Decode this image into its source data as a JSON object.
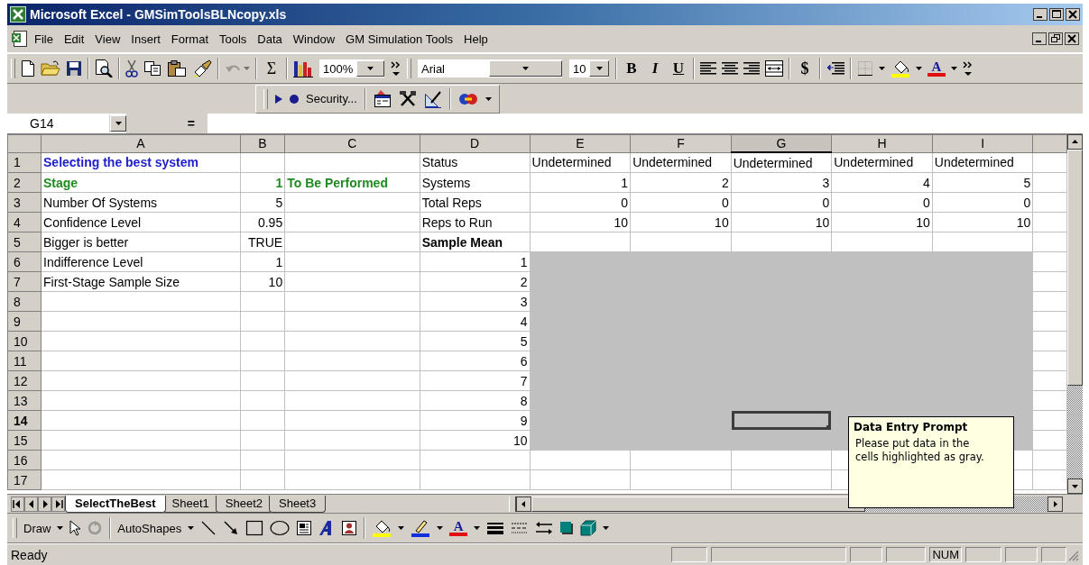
{
  "window": {
    "title": "Microsoft Excel - GMSimToolsBLNcopy.xls"
  },
  "menu": [
    "File",
    "Edit",
    "View",
    "Insert",
    "Format",
    "Tools",
    "Data",
    "Window",
    "GM Simulation Tools",
    "Help"
  ],
  "toolbar": {
    "undo_disabled": true,
    "sum": "Σ",
    "zoom": "100%",
    "font": "Arial",
    "font_size": "10",
    "bold": "B",
    "italic": "I",
    "underline": "U",
    "currency": "$",
    "font_color": "A"
  },
  "macro_toolbar": {
    "security": "Security..."
  },
  "formula_bar": {
    "name_box": "G14",
    "equals": "="
  },
  "sheet": {
    "columns": [
      {
        "label": "A",
        "selected": false
      },
      {
        "label": "B",
        "selected": false
      },
      {
        "label": "C",
        "selected": false
      },
      {
        "label": "D",
        "selected": false
      },
      {
        "label": "E",
        "selected": false
      },
      {
        "label": "F",
        "selected": false
      },
      {
        "label": "G",
        "selected": true
      },
      {
        "label": "H",
        "selected": false
      },
      {
        "label": "I",
        "selected": false
      }
    ],
    "rows": [
      {
        "label": "1",
        "selected": false,
        "cells": [
          {
            "text": "Selecting the best system",
            "kind": "title",
            "highlighted": false,
            "selected": false
          },
          {
            "kind": "empty",
            "highlighted": false,
            "selected": false
          },
          {
            "kind": "empty",
            "highlighted": false,
            "selected": false
          },
          {
            "text": "Status",
            "kind": "text",
            "highlighted": false,
            "selected": false
          },
          {
            "text": "Undetermined",
            "kind": "text",
            "highlighted": false,
            "selected": false
          },
          {
            "text": "Undetermined",
            "kind": "text",
            "highlighted": false,
            "selected": false
          },
          {
            "text": "Undetermined",
            "kind": "text",
            "highlighted": false,
            "selected": false
          },
          {
            "text": "Undetermined",
            "kind": "text",
            "highlighted": false,
            "selected": false
          },
          {
            "text": "Undetermined",
            "kind": "text",
            "highlighted": false,
            "selected": false
          }
        ]
      },
      {
        "label": "2",
        "selected": false,
        "cells": [
          {
            "text": "Stage",
            "kind": "stage",
            "highlighted": false,
            "selected": false
          },
          {
            "text": "1",
            "kind": "stage_number",
            "highlighted": false,
            "selected": false
          },
          {
            "text": "To Be Performed",
            "kind": "stage",
            "highlighted": false,
            "selected": false
          },
          {
            "text": "Systems",
            "kind": "text",
            "highlighted": false,
            "selected": false
          },
          {
            "text": "1",
            "kind": "number",
            "highlighted": false,
            "selected": false
          },
          {
            "text": "2",
            "kind": "number",
            "highlighted": false,
            "selected": false
          },
          {
            "text": "3",
            "kind": "number",
            "highlighted": false,
            "selected": false
          },
          {
            "text": "4",
            "kind": "number",
            "highlighted": false,
            "selected": false
          },
          {
            "text": "5",
            "kind": "number",
            "highlighted": false,
            "selected": false
          }
        ]
      },
      {
        "label": "3",
        "selected": false,
        "cells": [
          {
            "text": "Number Of Systems",
            "kind": "text",
            "highlighted": false,
            "selected": false
          },
          {
            "text": "5",
            "kind": "number",
            "highlighted": false,
            "selected": false
          },
          {
            "kind": "empty",
            "highlighted": false,
            "selected": false
          },
          {
            "text": "Total Reps",
            "kind": "text",
            "highlighted": false,
            "selected": false
          },
          {
            "text": "0",
            "kind": "number",
            "highlighted": false,
            "selected": false
          },
          {
            "text": "0",
            "kind": "number",
            "highlighted": false,
            "selected": false
          },
          {
            "text": "0",
            "kind": "number",
            "highlighted": false,
            "selected": false
          },
          {
            "text": "0",
            "kind": "number",
            "highlighted": false,
            "selected": false
          },
          {
            "text": "0",
            "kind": "number",
            "highlighted": false,
            "selected": false
          }
        ]
      },
      {
        "label": "4",
        "selected": false,
        "cells": [
          {
            "text": "Confidence Level",
            "kind": "text",
            "highlighted": false,
            "selected": false
          },
          {
            "text": "0.95",
            "kind": "number",
            "highlighted": false,
            "selected": false
          },
          {
            "kind": "empty",
            "highlighted": false,
            "selected": false
          },
          {
            "text": "Reps to Run",
            "kind": "text",
            "highlighted": false,
            "selected": false
          },
          {
            "text": "10",
            "kind": "number",
            "highlighted": false,
            "selected": false
          },
          {
            "text": "10",
            "kind": "number",
            "highlighted": false,
            "selected": false
          },
          {
            "text": "10",
            "kind": "number",
            "highlighted": false,
            "selected": false
          },
          {
            "text": "10",
            "kind": "number",
            "highlighted": false,
            "selected": false
          },
          {
            "text": "10",
            "kind": "number",
            "highlighted": false,
            "selected": false
          }
        ]
      },
      {
        "label": "5",
        "selected": false,
        "cells": [
          {
            "text": "Bigger is better",
            "kind": "text",
            "highlighted": false,
            "selected": false
          },
          {
            "text": "TRUE",
            "kind": "number",
            "highlighted": false,
            "selected": false
          },
          {
            "kind": "empty",
            "highlighted": false,
            "selected": false
          },
          {
            "text": "Sample Mean",
            "kind": "heading",
            "highlighted": false,
            "selected": false
          },
          {
            "kind": "empty",
            "highlighted": false,
            "selected": false
          },
          {
            "kind": "empty",
            "highlighted": false,
            "selected": false
          },
          {
            "kind": "empty",
            "highlighted": false,
            "selected": false
          },
          {
            "kind": "empty",
            "highlighted": false,
            "selected": false
          },
          {
            "kind": "empty",
            "highlighted": false,
            "selected": false
          }
        ]
      },
      {
        "label": "6",
        "selected": false,
        "cells": [
          {
            "text": "Indifference Level",
            "kind": "text",
            "highlighted": false,
            "selected": false
          },
          {
            "text": "1",
            "kind": "number",
            "highlighted": false,
            "selected": false
          },
          {
            "kind": "empty",
            "highlighted": false,
            "selected": false
          },
          {
            "text": "1",
            "kind": "number",
            "highlighted": false,
            "selected": false
          },
          {
            "kind": "empty",
            "highlighted": true,
            "selected": false
          },
          {
            "kind": "empty",
            "highlighted": true,
            "selected": false
          },
          {
            "kind": "empty",
            "highlighted": true,
            "selected": false
          },
          {
            "kind": "empty",
            "highlighted": true,
            "selected": false
          },
          {
            "kind": "empty",
            "highlighted": true,
            "selected": false
          }
        ]
      },
      {
        "label": "7",
        "selected": false,
        "cells": [
          {
            "text": "First-Stage Sample Size",
            "kind": "text",
            "highlighted": false,
            "selected": false
          },
          {
            "text": "10",
            "kind": "number",
            "highlighted": false,
            "selected": false
          },
          {
            "kind": "empty",
            "highlighted": false,
            "selected": false
          },
          {
            "text": "2",
            "kind": "number",
            "highlighted": false,
            "selected": false
          },
          {
            "kind": "empty",
            "highlighted": true,
            "selected": false
          },
          {
            "kind": "empty",
            "highlighted": true,
            "selected": false
          },
          {
            "kind": "empty",
            "highlighted": true,
            "selected": false
          },
          {
            "kind": "empty",
            "highlighted": true,
            "selected": false
          },
          {
            "kind": "empty",
            "highlighted": true,
            "selected": false
          }
        ]
      },
      {
        "label": "8",
        "selected": false,
        "cells": [
          {
            "kind": "empty",
            "highlighted": false,
            "selected": false
          },
          {
            "kind": "empty",
            "highlighted": false,
            "selected": false
          },
          {
            "kind": "empty",
            "highlighted": false,
            "selected": false
          },
          {
            "text": "3",
            "kind": "number",
            "highlighted": false,
            "selected": false
          },
          {
            "kind": "empty",
            "highlighted": true,
            "selected": false
          },
          {
            "kind": "empty",
            "highlighted": true,
            "selected": false
          },
          {
            "kind": "empty",
            "highlighted": true,
            "selected": false
          },
          {
            "kind": "empty",
            "highlighted": true,
            "selected": false
          },
          {
            "kind": "empty",
            "highlighted": true,
            "selected": false
          }
        ]
      },
      {
        "label": "9",
        "selected": false,
        "cells": [
          {
            "kind": "empty",
            "highlighted": false,
            "selected": false
          },
          {
            "kind": "empty",
            "highlighted": false,
            "selected": false
          },
          {
            "kind": "empty",
            "highlighted": false,
            "selected": false
          },
          {
            "text": "4",
            "kind": "number",
            "highlighted": false,
            "selected": false
          },
          {
            "kind": "empty",
            "highlighted": true,
            "selected": false
          },
          {
            "kind": "empty",
            "highlighted": true,
            "selected": false
          },
          {
            "kind": "empty",
            "highlighted": true,
            "selected": false
          },
          {
            "kind": "empty",
            "highlighted": true,
            "selected": false
          },
          {
            "kind": "empty",
            "highlighted": true,
            "selected": false
          }
        ]
      },
      {
        "label": "10",
        "selected": false,
        "cells": [
          {
            "kind": "empty",
            "highlighted": false,
            "selected": false
          },
          {
            "kind": "empty",
            "highlighted": false,
            "selected": false
          },
          {
            "kind": "empty",
            "highlighted": false,
            "selected": false
          },
          {
            "text": "5",
            "kind": "number",
            "highlighted": false,
            "selected": false
          },
          {
            "kind": "empty",
            "highlighted": true,
            "selected": false
          },
          {
            "kind": "empty",
            "highlighted": true,
            "selected": false
          },
          {
            "kind": "empty",
            "highlighted": true,
            "selected": false
          },
          {
            "kind": "empty",
            "highlighted": true,
            "selected": false
          },
          {
            "kind": "empty",
            "highlighted": true,
            "selected": false
          }
        ]
      },
      {
        "label": "11",
        "selected": false,
        "cells": [
          {
            "kind": "empty",
            "highlighted": false,
            "selected": false
          },
          {
            "kind": "empty",
            "highlighted": false,
            "selected": false
          },
          {
            "kind": "empty",
            "highlighted": false,
            "selected": false
          },
          {
            "text": "6",
            "kind": "number",
            "highlighted": false,
            "selected": false
          },
          {
            "kind": "empty",
            "highlighted": true,
            "selected": false
          },
          {
            "kind": "empty",
            "highlighted": true,
            "selected": false
          },
          {
            "kind": "empty",
            "highlighted": true,
            "selected": false
          },
          {
            "kind": "empty",
            "highlighted": true,
            "selected": false
          },
          {
            "kind": "empty",
            "highlighted": true,
            "selected": false
          }
        ]
      },
      {
        "label": "12",
        "selected": false,
        "cells": [
          {
            "kind": "empty",
            "highlighted": false,
            "selected": false
          },
          {
            "kind": "empty",
            "highlighted": false,
            "selected": false
          },
          {
            "kind": "empty",
            "highlighted": false,
            "selected": false
          },
          {
            "text": "7",
            "kind": "number",
            "highlighted": false,
            "selected": false
          },
          {
            "kind": "empty",
            "highlighted": true,
            "selected": false
          },
          {
            "kind": "empty",
            "highlighted": true,
            "selected": false
          },
          {
            "kind": "empty",
            "highlighted": true,
            "selected": false
          },
          {
            "kind": "empty",
            "highlighted": true,
            "selected": false
          },
          {
            "kind": "empty",
            "highlighted": true,
            "selected": false
          }
        ]
      },
      {
        "label": "13",
        "selected": false,
        "cells": [
          {
            "kind": "empty",
            "highlighted": false,
            "selected": false
          },
          {
            "kind": "empty",
            "highlighted": false,
            "selected": false
          },
          {
            "kind": "empty",
            "highlighted": false,
            "selected": false
          },
          {
            "text": "8",
            "kind": "number",
            "highlighted": false,
            "selected": false
          },
          {
            "kind": "empty",
            "highlighted": true,
            "selected": false
          },
          {
            "kind": "empty",
            "highlighted": true,
            "selected": false
          },
          {
            "kind": "empty",
            "highlighted": true,
            "selected": false
          },
          {
            "kind": "empty",
            "highlighted": true,
            "selected": false
          },
          {
            "kind": "empty",
            "highlighted": true,
            "selected": false
          }
        ]
      },
      {
        "label": "14",
        "selected": true,
        "cells": [
          {
            "kind": "empty",
            "highlighted": false,
            "selected": false
          },
          {
            "kind": "empty",
            "highlighted": false,
            "selected": false
          },
          {
            "kind": "empty",
            "highlighted": false,
            "selected": false
          },
          {
            "text": "9",
            "kind": "number",
            "highlighted": false,
            "selected": false
          },
          {
            "kind": "empty",
            "highlighted": true,
            "selected": false
          },
          {
            "kind": "empty",
            "highlighted": true,
            "selected": false
          },
          {
            "kind": "empty",
            "highlighted": true,
            "selected": true
          },
          {
            "kind": "empty",
            "highlighted": true,
            "selected": false
          },
          {
            "kind": "empty",
            "highlighted": true,
            "selected": false
          }
        ]
      },
      {
        "label": "15",
        "selected": false,
        "cells": [
          {
            "kind": "empty",
            "highlighted": false,
            "selected": false
          },
          {
            "kind": "empty",
            "highlighted": false,
            "selected": false
          },
          {
            "kind": "empty",
            "highlighted": false,
            "selected": false
          },
          {
            "text": "10",
            "kind": "number",
            "highlighted": false,
            "selected": false
          },
          {
            "kind": "empty",
            "highlighted": true,
            "selected": false
          },
          {
            "kind": "empty",
            "highlighted": true,
            "selected": false
          },
          {
            "kind": "empty",
            "highlighted": true,
            "selected": false
          },
          {
            "kind": "empty",
            "highlighted": true,
            "selected": false
          },
          {
            "kind": "empty",
            "highlighted": true,
            "selected": false
          }
        ]
      },
      {
        "label": "16",
        "selected": false,
        "cells": [
          {
            "kind": "empty",
            "highlighted": false,
            "selected": false
          },
          {
            "kind": "empty",
            "highlighted": false,
            "selected": false
          },
          {
            "kind": "empty",
            "highlighted": false,
            "selected": false
          },
          {
            "kind": "empty",
            "highlighted": false,
            "selected": false
          },
          {
            "kind": "empty",
            "highlighted": false,
            "selected": false
          },
          {
            "kind": "empty",
            "highlighted": false,
            "selected": false
          },
          {
            "kind": "empty",
            "highlighted": false,
            "selected": false
          },
          {
            "kind": "empty",
            "highlighted": false,
            "selected": false
          },
          {
            "kind": "empty",
            "highlighted": false,
            "selected": false
          }
        ]
      },
      {
        "label": "17",
        "selected": false,
        "cells": [
          {
            "kind": "empty",
            "highlighted": false,
            "selected": false
          },
          {
            "kind": "empty",
            "highlighted": false,
            "selected": false
          },
          {
            "kind": "empty",
            "highlighted": false,
            "selected": false
          },
          {
            "kind": "empty",
            "highlighted": false,
            "selected": false
          },
          {
            "kind": "empty",
            "highlighted": false,
            "selected": false
          },
          {
            "kind": "empty",
            "highlighted": false,
            "selected": false
          },
          {
            "kind": "empty",
            "highlighted": false,
            "selected": false
          },
          {
            "kind": "empty",
            "highlighted": false,
            "selected": false
          },
          {
            "kind": "empty",
            "highlighted": false,
            "selected": false
          }
        ]
      }
    ]
  },
  "sheet_tabs": [
    {
      "label": "SelectTheBest",
      "selected": true
    },
    {
      "label": "Sheet1",
      "selected": false
    },
    {
      "label": "Sheet2",
      "selected": false
    },
    {
      "label": "Sheet3",
      "selected": false
    }
  ],
  "prompt": {
    "title": "Data Entry Prompt",
    "text": "Please put data in the cells highlighted as gray."
  },
  "drawing_toolbar": {
    "draw": "Draw",
    "autoshapes": "AutoShapes",
    "font_color": "A"
  },
  "status_bar": {
    "text": "Ready",
    "indicators": [
      "NUM"
    ]
  }
}
